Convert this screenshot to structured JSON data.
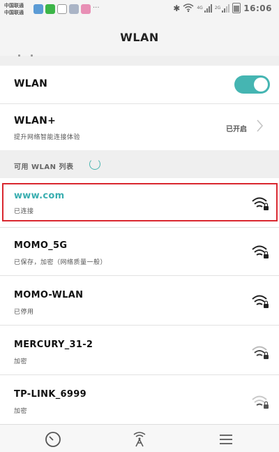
{
  "status_bar": {
    "carrier_1": "中国联通",
    "carrier_2": "中国联通",
    "signal_badge_1": "4G",
    "signal_badge_2": "2G",
    "time": "16:06"
  },
  "header": {
    "title": "WLAN"
  },
  "wlan_toggle": {
    "label": "WLAN",
    "on": true,
    "accent_color": "#45b5b2"
  },
  "wlan_plus": {
    "label": "WLAN+",
    "subtitle": "提升网络智能连接体验",
    "status": "已开启"
  },
  "section": {
    "label": "可用 WLAN 列表"
  },
  "networks": [
    {
      "ssid": "www.com",
      "status": "已连接",
      "connected": true,
      "highlight_color": "#d9272f",
      "ssid_color": "#3aaeb0"
    },
    {
      "ssid": "MOMO_5G",
      "status": "已保存，加密（网络质量一般）"
    },
    {
      "ssid": "MOMO-WLAN",
      "status": "已停用"
    },
    {
      "ssid": "MERCURY_31-2",
      "status": "加密"
    },
    {
      "ssid": "TP-LINK_6999",
      "status": "加密"
    }
  ],
  "bottom_nav": {
    "items": [
      {
        "icon": "speed-test-icon"
      },
      {
        "icon": "wifi-tower-icon"
      },
      {
        "icon": "menu-icon"
      }
    ]
  }
}
